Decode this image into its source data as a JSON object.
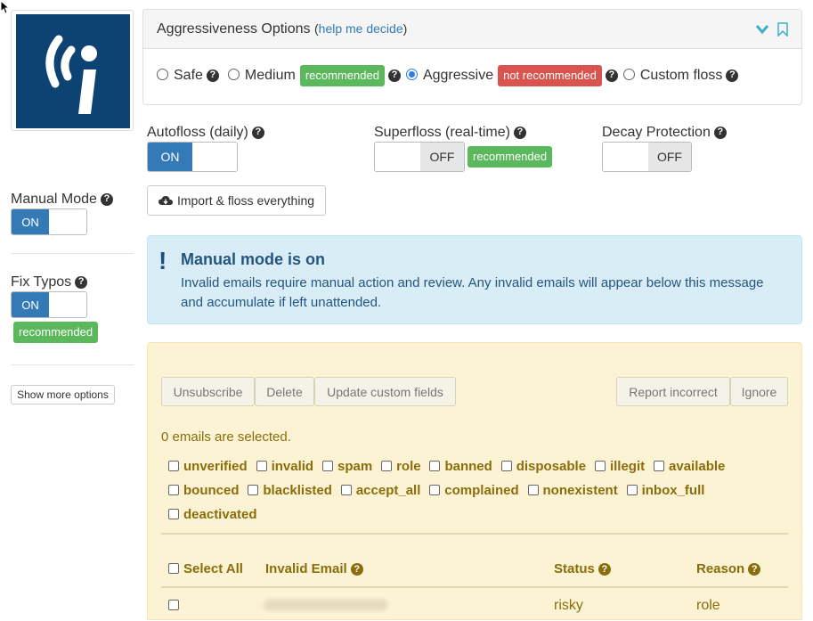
{
  "logo": {
    "alt": "floss logo",
    "colors": {
      "bg": "#0d4372",
      "fg": "#ffffff"
    }
  },
  "aggressiveness": {
    "title": "Aggressiveness Options",
    "paren_open": "(",
    "help_link": "help me decide",
    "paren_close": ")",
    "options": [
      {
        "label": "Safe"
      },
      {
        "label": "Medium",
        "badge": "recommended"
      },
      {
        "label": "Aggressive",
        "badge": "not recommended",
        "selected": true
      },
      {
        "label": "Custom floss"
      }
    ]
  },
  "autofloss": {
    "label": "Autofloss (daily)",
    "state": "ON"
  },
  "superfloss": {
    "label": "Superfloss (real-time)",
    "state": "OFF",
    "badge": "recommended"
  },
  "decay": {
    "label": "Decay Protection",
    "state": "OFF"
  },
  "import_button": "Import & floss everything",
  "manual_mode": {
    "label": "Manual Mode",
    "state": "ON"
  },
  "fix_typos": {
    "label": "Fix Typos",
    "state": "ON",
    "badge": "recommended"
  },
  "show_more": "Show more options",
  "alert": {
    "icon": "!",
    "title": "Manual mode is on",
    "body": "Invalid emails require manual action and review. Any invalid emails will appear below this message and accumulate if left unattended."
  },
  "actions": {
    "unsubscribe": "Unsubscribe",
    "delete": "Delete",
    "update_custom": "Update custom fields",
    "report_incorrect": "Report incorrect",
    "ignore": "Ignore"
  },
  "selected_count": "0 emails are selected.",
  "filters": [
    "unverified",
    "invalid",
    "spam",
    "role",
    "banned",
    "disposable",
    "illegit",
    "available",
    "bounced",
    "blacklisted",
    "accept_all",
    "complained",
    "nonexistent",
    "inbox_full",
    "deactivated"
  ],
  "table": {
    "select_all": "Select All",
    "col_email": "Invalid Email",
    "col_status": "Status",
    "col_reason": "Reason",
    "rows": [
      {
        "status": "risky",
        "reason": "role"
      }
    ]
  },
  "colors": {
    "primary": "#337ab7",
    "success": "#5cb85c",
    "danger": "#d9534f",
    "alert_bg": "#d9edf7",
    "warning_bg": "#fcf3d5"
  }
}
